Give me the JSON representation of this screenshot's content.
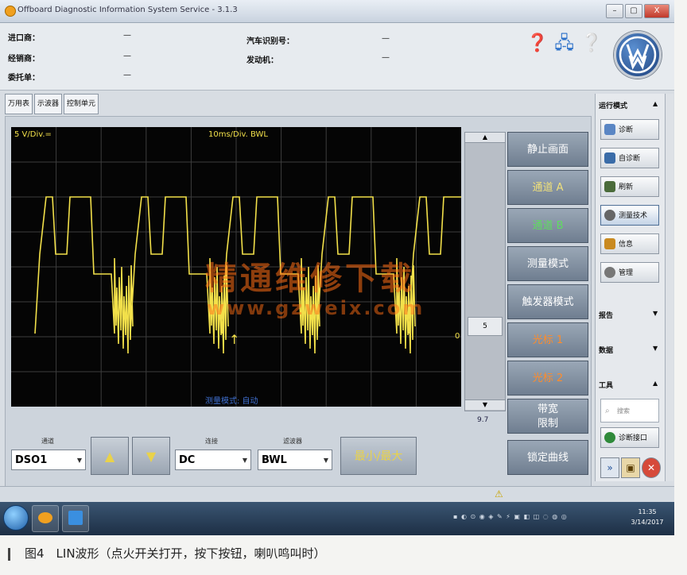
{
  "window": {
    "title": "Offboard Diagnostic Information System Service - 3.1.3",
    "min": "–",
    "max": "▢",
    "close": "X"
  },
  "header": {
    "importer_label": "进口商：",
    "importer_value": "—",
    "dealer_label": "经销商：",
    "dealer_value": "—",
    "order_label": "委托单：",
    "order_value": "—",
    "vin_label": "汽车识别号：",
    "vin_value": "—",
    "engine_label": "发动机：",
    "engine_value": "—"
  },
  "tabs": [
    "万用表",
    "示波器",
    "控制单元"
  ],
  "scope": {
    "scale": "5 V/Div.=",
    "timebase": "10ms/Div. BWL",
    "mode_text": "测量模式: 自动",
    "zero_mark": "0",
    "trigger_marker": "↑"
  },
  "scrollbar": {
    "up": "▲",
    "down": "▼",
    "thumb": "5",
    "value": "9.7"
  },
  "right_buttons": {
    "freeze": "静止画面",
    "channel_a": "通道 A",
    "channel_b": "通道 B",
    "measure_mode": "测量模式",
    "trigger_mode": "触发器模式",
    "cursor1": "光标 1",
    "cursor2": "光标 2",
    "bandwidth_l1": "带宽",
    "bandwidth_l2": "限制",
    "fix_curve": "锁定曲线"
  },
  "controls": {
    "channel_label": "通道",
    "channel_value": "DSO1",
    "up_arrow": "▲",
    "down_arrow": "▼",
    "coupling_label": "连接",
    "coupling_value": "DC",
    "filter_label": "滤波器",
    "filter_value": "BWL",
    "minmax": "最小/最大"
  },
  "sidebar": {
    "operation_mode": "运行模式",
    "items": [
      "诊断",
      "自诊断",
      "刷新",
      "测量技术",
      "信息",
      "管理"
    ],
    "reports": "报告",
    "data": "数据",
    "tools": "工具",
    "search_placeholder": "搜索",
    "diag_port": "诊断接口",
    "expand": "»",
    "restore": "▣",
    "close": "✕"
  },
  "watermark": {
    "cn": "精通维修下载",
    "url": "www.gzweix.com"
  },
  "taskbar": {
    "tray": "▪ ◐ ⊙ ◉ ◈ ✎ ⚡ ▣ ◧ ◫ ◌ ◍ ◎",
    "time": "11:35",
    "date": "3/14/2017"
  },
  "caption": "图4　LIN波形（点火开关打开，按下按钮，喇叭鸣叫时）",
  "colors": {
    "trace": "#f2e04a",
    "grid": "#3d3d3d",
    "screen": "#050505",
    "button": "#7f8da0",
    "channel_a_text": "#f0e07a",
    "channel_b_text": "#5fdc5f",
    "cursor_text": "#ff8c2a"
  }
}
